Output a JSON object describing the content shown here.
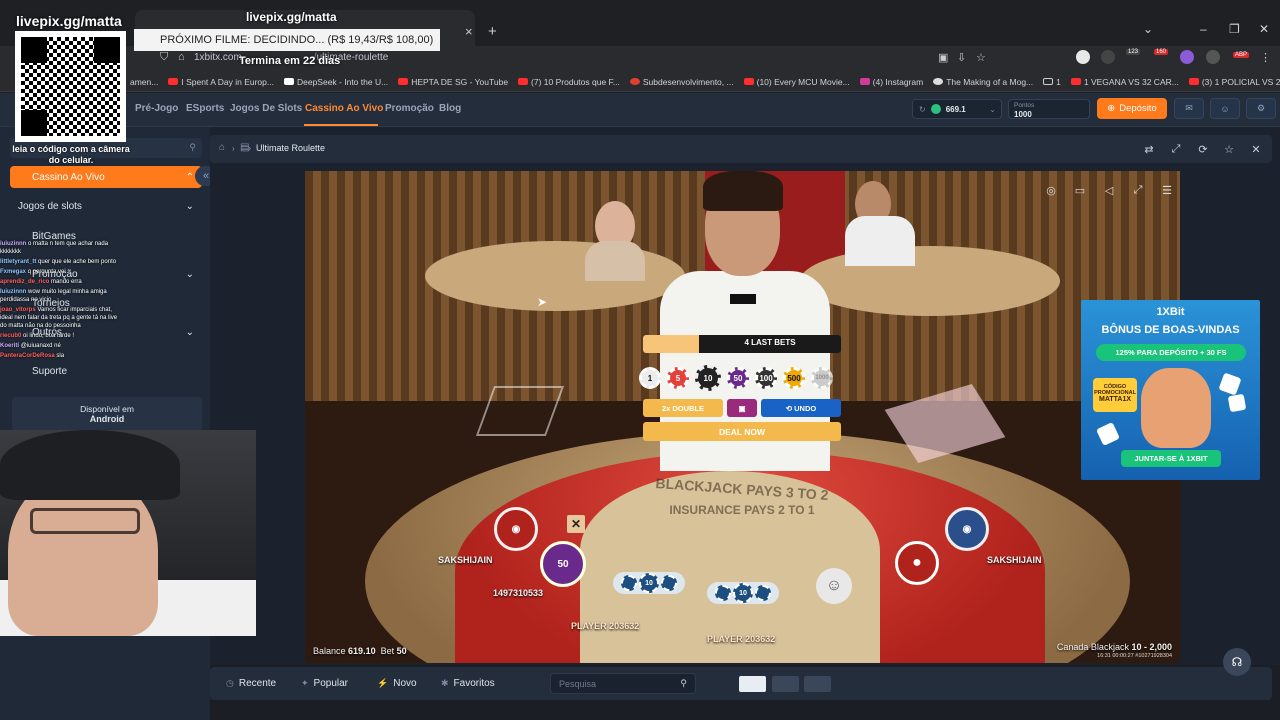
{
  "browser": {
    "url": "1xbitx.com",
    "url_path": "ultimate-roulette",
    "bookmarks": [
      "amen...",
      "I Spent A Day in Europ...",
      "DeepSeek - Into the U...",
      "HEPTA DE SG - YouTube",
      "(7) 10 Produtos que F...",
      "Subdesenvolvimento, ...",
      "(10) Every MCU Movie...",
      "(4) Instagram",
      "The Making of a Mog...",
      "1",
      "1 VEGANA VS 32 CAR...",
      "(3) 1 POLICIAL VS 25 E..."
    ],
    "ext_badges": [
      "123",
      "160",
      "ABP"
    ]
  },
  "site": {
    "nav": [
      "Pré-Jogo",
      "ESports",
      "Jogos De Slots",
      "Cassino Ao Vivo",
      "Promoção",
      "Blog"
    ],
    "balance": "669.1",
    "points_label": "Pontos",
    "points_value": "1000",
    "deposit_label": "Depósito"
  },
  "sidebar": {
    "items": [
      "Cassino Ao Vivo",
      "Jogos de slots",
      "BitGames",
      "Promoção",
      "Torneios",
      "Outros",
      "Suporte"
    ],
    "android_top": "Disponível em",
    "android_bottom": "Android"
  },
  "content": {
    "breadcrumb": "Ultimate Roulette"
  },
  "game": {
    "last_bets_label": "4 LAST BETS",
    "chips": [
      "1",
      "5",
      "10",
      "50",
      "100",
      "500",
      "1000"
    ],
    "double_label": "2x DOUBLE",
    "undo_label": "UNDO",
    "deal_label": "DEAL NOW",
    "seat_left": "SAKSHIJAIN",
    "seat_right": "SAKSHIJAIN",
    "player_a": "1497310533",
    "player_b": "PLAYER 203632",
    "player_c": "PLAYER 203632",
    "balance_label": "Balance",
    "balance_value": "619.10",
    "bet_label": "Bet",
    "bet_value": "50",
    "table_name": "Canada Blackjack",
    "table_limits": "10 - 2,000",
    "table_id": "16:31  00:00:27  #10271928304",
    "felt_text_1": "BLACKJACK PAYS 3 TO 2",
    "felt_text_2": "INSURANCE PAYS 2 TO 1",
    "chip_on_table": "50",
    "stack_value": "10"
  },
  "bottom": {
    "tabs": [
      "Recente",
      "Popular",
      "Novo",
      "Favoritos"
    ],
    "search_placeholder": "Pesquisa"
  },
  "overlay": {
    "livepix": "livepix.gg/matta",
    "qr_caption": "leia o código com a câmera do celular.",
    "proximo": "PRÓXIMO FILME: DECIDINDO... (R$ 19,43/R$ 108,00)",
    "termina": "Termina em 22 dias",
    "chat": [
      {
        "user": "iuiuzinnn",
        "msg": "o matta n tem que achar nada kkkkkkk"
      },
      {
        "user": "littletyrant_tt",
        "msg": "quer que ele ache bem ponto"
      },
      {
        "user": "Fxmegax",
        "msg": "q pergunta vei"
      },
      {
        "user": "aprendiz_de_rico",
        "msg": "mando erra"
      },
      {
        "user": "Iuiuzinnn",
        "msg": "wow muito legal minha amiga perdidassa no vicio"
      },
      {
        "user": "joao_vitorps",
        "msg": "Vamos ficar imparciais chat, ideal nem falar da treta pq a gente tá na live do matta não na do pessoinha"
      },
      {
        "user": "riecub0",
        "msg": "oi lindo, boa tarde !"
      },
      {
        "user": "Koeriti",
        "msg": "@iuiuanaxd né"
      },
      {
        "user": "PanteraCorDeRosa",
        "msg": "sla"
      }
    ]
  },
  "ad": {
    "brand": "1XBit",
    "title": "BÔNUS DE BOAS-VINDAS",
    "pill": "125% PARA DEPÓSITO + 30 FS",
    "promo_label": "CÓDIGO PROMOCIONAL",
    "promo_code": "MATTA1X",
    "cta": "JUNTAR-SE À 1XBIT"
  }
}
